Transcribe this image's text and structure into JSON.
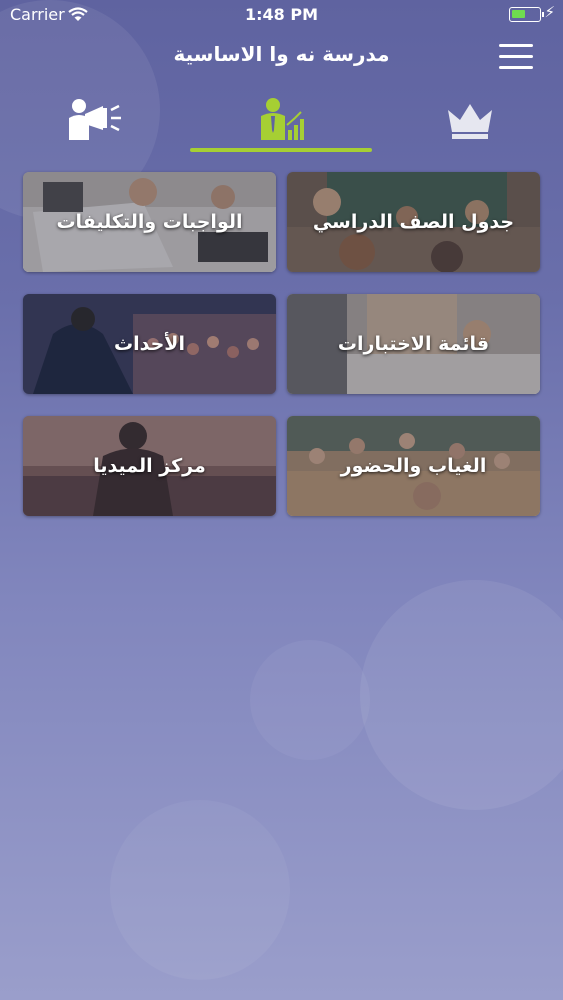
{
  "status_bar": {
    "carrier": "Carrier",
    "time": "1:48 PM"
  },
  "header": {
    "title": "مدرسة نه وا الاساسية"
  },
  "tabs": [
    {
      "icon": "megaphone-person-icon"
    },
    {
      "icon": "person-growth-icon",
      "active": true
    },
    {
      "icon": "crown-icon"
    }
  ],
  "tiles": {
    "schedule": {
      "label": "جدول الصف الدراسي"
    },
    "homework": {
      "label": "الواجبات والتكليفات"
    },
    "exams": {
      "label": "قائمة الاختبارات"
    },
    "events": {
      "label": "الأحداث"
    },
    "attendance": {
      "label": "الغياب والحضور"
    },
    "media": {
      "label": "مركز الميديا"
    }
  },
  "colors": {
    "accent": "#a6cf33",
    "background_top": "#5f63a0",
    "background_bottom": "#9a9ecb"
  }
}
